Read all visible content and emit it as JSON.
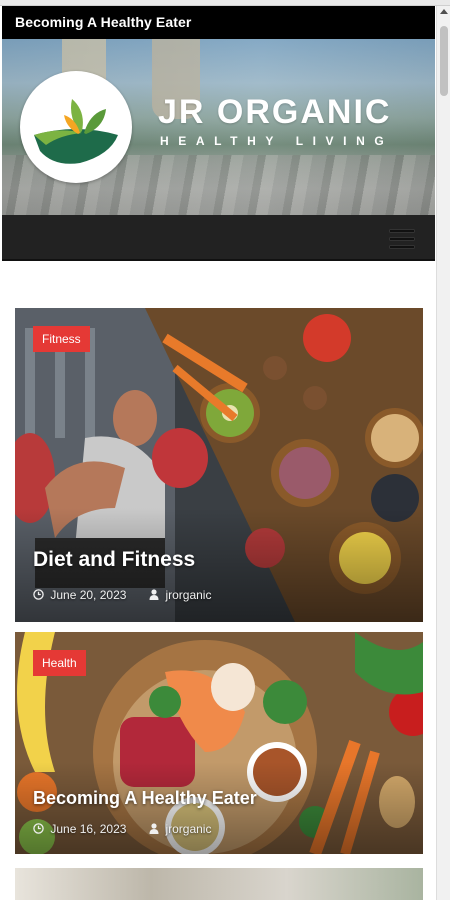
{
  "site": {
    "top_title": "Becoming A Healthy Eater",
    "brand_name": "JR ORGANIC",
    "brand_tagline": "HEALTHY LIVING"
  },
  "colors": {
    "badge": "#e53935",
    "topbar": "#000000",
    "navbar": "#222222",
    "logo_green_dark": "#1e6b4a",
    "logo_green_light": "#7cb342",
    "logo_orange": "#f5a623"
  },
  "icons": {
    "menu": "hamburger-menu-icon",
    "date": "clock-icon",
    "author": "user-icon"
  },
  "posts": [
    {
      "category": "Fitness",
      "title": "Diet and Fitness",
      "date": "June 20, 2023",
      "author": "jrorganic"
    },
    {
      "category": "Health",
      "title": "Becoming A Healthy Eater",
      "date": "June 16, 2023",
      "author": "jrorganic"
    }
  ]
}
